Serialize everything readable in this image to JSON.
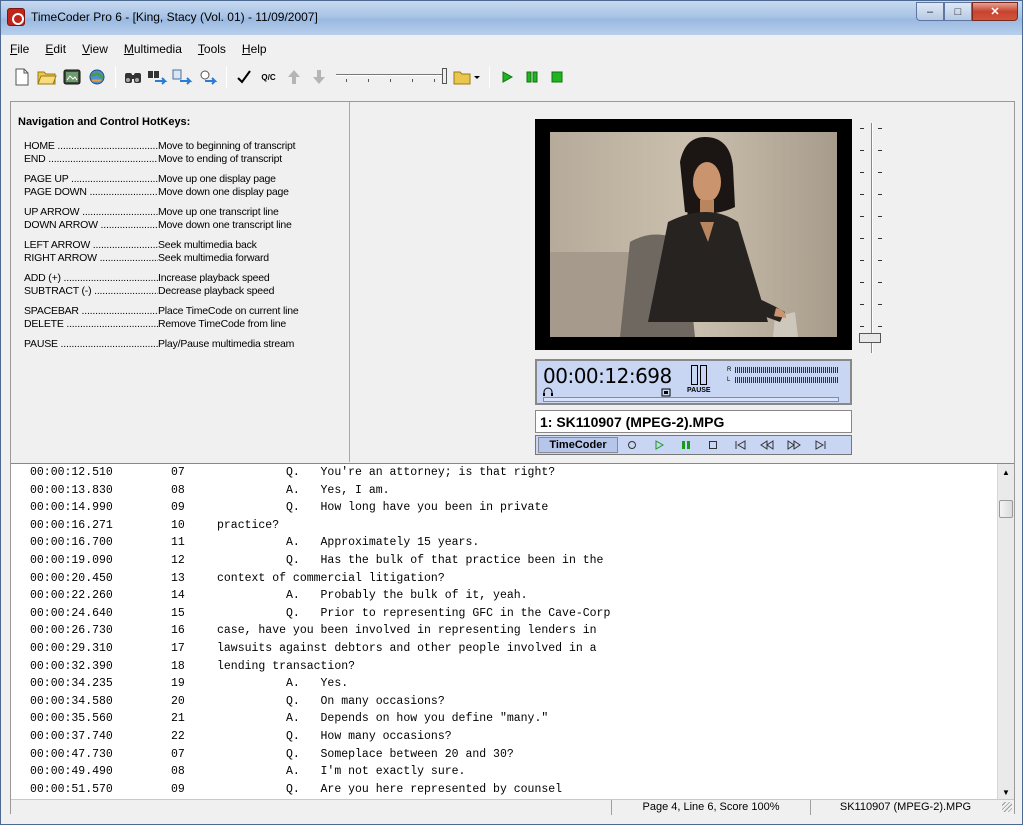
{
  "window": {
    "title": "TimeCoder Pro 6 - [King, Stacy (Vol. 01) - 11/09/2007]",
    "min_glyph": "–",
    "max_glyph": "□",
    "close_glyph": "✕"
  },
  "menu": [
    {
      "label": "File",
      "access": "F",
      "rest": "ile"
    },
    {
      "label": "Edit",
      "access": "E",
      "rest": "dit"
    },
    {
      "label": "View",
      "access": "V",
      "rest": "iew"
    },
    {
      "label": "Multimedia",
      "access": "M",
      "rest": "ultimedia"
    },
    {
      "label": "Tools",
      "access": "T",
      "rest": "ools"
    },
    {
      "label": "Help",
      "access": "H",
      "rest": "elp"
    }
  ],
  "toolbar": {
    "qc_label": "Q/C",
    "icons": [
      "new-document-icon",
      "open-folder-icon",
      "record-icon",
      "globe-icon",
      "binoculars-icon",
      "find-next-icon",
      "find-prev-icon",
      "replace-icon",
      "check-icon",
      "qc-icon",
      "up-arrow-icon",
      "down-arrow-icon",
      "speed-slider",
      "folder-dropdown-icon",
      "play-icon",
      "pause-icon",
      "stop-icon"
    ]
  },
  "nav": {
    "title": "Navigation and Control HotKeys:",
    "groups": [
      [
        {
          "key": "HOME",
          "desc": "Move to beginning of transcript"
        },
        {
          "key": "END",
          "desc": "Move to ending of transcript"
        }
      ],
      [
        {
          "key": "PAGE UP",
          "desc": "Move up one display page"
        },
        {
          "key": "PAGE DOWN",
          "desc": "Move down one display page"
        }
      ],
      [
        {
          "key": "UP ARROW",
          "desc": "Move up one transcript line"
        },
        {
          "key": "DOWN ARROW",
          "desc": "Move down one transcript line"
        }
      ],
      [
        {
          "key": "LEFT ARROW",
          "desc": "Seek multimedia back"
        },
        {
          "key": "RIGHT ARROW",
          "desc": "Seek multimedia forward"
        }
      ],
      [
        {
          "key": "ADD (+)",
          "desc": "Increase playback speed"
        },
        {
          "key": "SUBTRACT (-)",
          "desc": "Decrease playback speed"
        }
      ],
      [
        {
          "key": "SPACEBAR",
          "desc": "Place TimeCode on current line"
        },
        {
          "key": "DELETE",
          "desc": "Remove TimeCode from line"
        }
      ],
      [
        {
          "key": "PAUSE",
          "desc": "Play/Pause multimedia stream"
        }
      ]
    ]
  },
  "player": {
    "timecode": "00:00:12:698",
    "pause_label": "PAUSE",
    "meter_r": "R",
    "meter_l": "L",
    "file_name": "1: SK110907 (MPEG-2).MPG",
    "control_label": "TimeCoder"
  },
  "transcript": [
    {
      "time": "00:00:12.510",
      "line": "07",
      "text": "          Q.   You're an attorney; is that right?"
    },
    {
      "time": "00:00:13.830",
      "line": "08",
      "text": "          A.   Yes, I am."
    },
    {
      "time": "00:00:14.990",
      "line": "09",
      "text": "          Q.   How long have you been in private"
    },
    {
      "time": "00:00:16.271",
      "line": "10",
      "text": "practice?"
    },
    {
      "time": "00:00:16.700",
      "line": "11",
      "text": "          A.   Approximately 15 years."
    },
    {
      "time": "00:00:19.090",
      "line": "12",
      "text": "          Q.   Has the bulk of that practice been in the"
    },
    {
      "time": "00:00:20.450",
      "line": "13",
      "text": "context of commercial litigation?"
    },
    {
      "time": "00:00:22.260",
      "line": "14",
      "text": "          A.   Probably the bulk of it, yeah."
    },
    {
      "time": "00:00:24.640",
      "line": "15",
      "text": "          Q.   Prior to representing GFC in the Cave-Corp"
    },
    {
      "time": "00:00:26.730",
      "line": "16",
      "text": "case, have you been involved in representing lenders in"
    },
    {
      "time": "00:00:29.310",
      "line": "17",
      "text": "lawsuits against debtors and other people involved in a"
    },
    {
      "time": "00:00:32.390",
      "line": "18",
      "text": "lending transaction?"
    },
    {
      "time": "00:00:34.235",
      "line": "19",
      "text": "          A.   Yes."
    },
    {
      "time": "00:00:34.580",
      "line": "20",
      "text": "          Q.   On many occasions?"
    },
    {
      "time": "00:00:35.560",
      "line": "21",
      "text": "          A.   Depends on how you define \"many.\""
    },
    {
      "time": "00:00:37.740",
      "line": "22",
      "text": "          Q.   How many occasions?"
    },
    {
      "time": "00:00:47.730",
      "line": "07",
      "text": "          Q.   Someplace between 20 and 30?"
    },
    {
      "time": "00:00:49.490",
      "line": "08",
      "text": "          A.   I'm not exactly sure."
    },
    {
      "time": "00:00:51.570",
      "line": "09",
      "text": "          Q.   Are you here represented by counsel"
    }
  ],
  "status": {
    "position": "Page 4, Line 6, Score 100%",
    "file": "SK110907 (MPEG-2).MPG"
  }
}
